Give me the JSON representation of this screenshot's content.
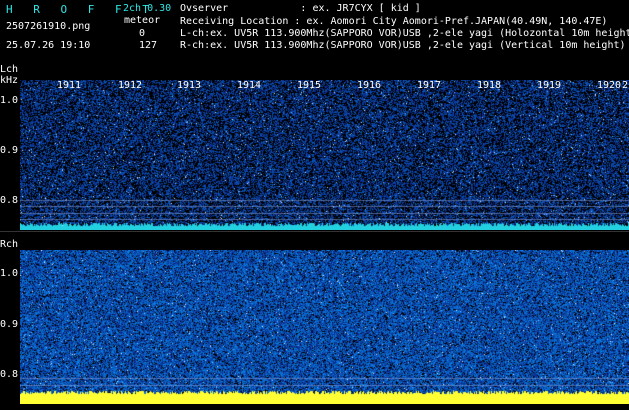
{
  "header": {
    "title": "H R O F F T",
    "file": "2507261910.png",
    "datetime": "25.07.26 19:10",
    "channel_mode": "2ch 0.30",
    "meteor_label": "meteor",
    "meteor_count_l": "0",
    "meteor_count_r": "127"
  },
  "info": {
    "observer": "Ovserver            : ex. JR7CYX [ kid ]",
    "location": "Receiving Location : ex. Aomori City Aomori-Pref.JAPAN(40.49N, 140.47E)",
    "lch": "L-ch:ex. UV5R 113.900Mhz(SAPPORO VOR)USB ,2-ele yagi (Holozontal 10m height",
    "rch": "R-ch:ex. UV5R 113.900Mhz(SAPPORO VOR)USB ,2-ele yagi (Vertical 10m height)"
  },
  "lch": {
    "label": "Lch",
    "unit": "kHz",
    "y_labels": [
      "1.0",
      "0.9",
      "0.8"
    ]
  },
  "rch": {
    "label": "Rch",
    "y_labels": [
      "1.0",
      "0.9",
      "0.8"
    ]
  },
  "time_axis": {
    "labels": [
      "1911",
      "1912",
      "1913",
      "1914",
      "1915",
      "1916",
      "1917",
      "1918",
      "1919",
      "1920",
      "2"
    ]
  },
  "colors": {
    "header_text": "#2ee6e6",
    "label_text": "#ffffff",
    "lch_noise": "#1a3a9a",
    "rch_noise": "#1f50c8",
    "baseline_l": "#22d0e0",
    "baseline_r": "#ffff33"
  }
}
